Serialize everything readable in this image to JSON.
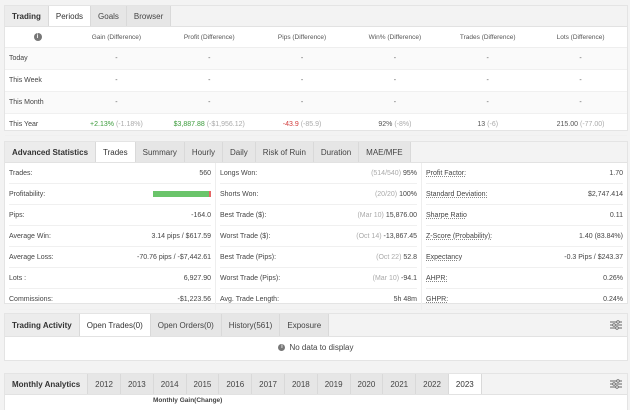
{
  "periods": {
    "tabs": [
      "Trading",
      "Periods",
      "Goals",
      "Browser"
    ],
    "headers": [
      "Gain (Difference)",
      "Profit (Difference)",
      "Pips (Difference)",
      "Win% (Difference)",
      "Trades (Difference)",
      "Lots (Difference)"
    ],
    "rows": [
      {
        "label": "Today",
        "gain": "-",
        "gain_diff": "",
        "profit": "-",
        "profit_diff": "",
        "pips": "-",
        "pips_diff": "",
        "win": "-",
        "win_diff": "",
        "trades": "-",
        "trades_diff": "",
        "lots": "-",
        "lots_diff": ""
      },
      {
        "label": "This Week",
        "gain": "-",
        "gain_diff": "",
        "profit": "-",
        "profit_diff": "",
        "pips": "-",
        "pips_diff": "",
        "win": "-",
        "win_diff": "",
        "trades": "-",
        "trades_diff": "",
        "lots": "-",
        "lots_diff": ""
      },
      {
        "label": "This Month",
        "gain": "-",
        "gain_diff": "",
        "profit": "-",
        "profit_diff": "",
        "pips": "-",
        "pips_diff": "",
        "win": "-",
        "win_diff": "",
        "trades": "-",
        "trades_diff": "",
        "lots": "-",
        "lots_diff": ""
      },
      {
        "label": "This Year",
        "gain": "+2.13%",
        "gain_diff": "(-1.18%)",
        "profit": "$3,887.88",
        "profit_diff": "(-$1,956.12)",
        "pips": "-43.9",
        "pips_diff": "(-85.9)",
        "win": "92%",
        "win_diff": "(-8%)",
        "trades": "13",
        "trades_diff": "(-6)",
        "lots": "215.00",
        "lots_diff": "(-77.00)"
      }
    ]
  },
  "stats": {
    "tabs": [
      "Advanced Statistics",
      "Trades",
      "Summary",
      "Hourly",
      "Daily",
      "Risk of Ruin",
      "Duration",
      "MAE/MFE"
    ],
    "col1": [
      {
        "label": "Trades:",
        "value": "560"
      },
      {
        "label": "Profitability:",
        "value": ""
      },
      {
        "label": "Pips:",
        "value": "-164.0"
      },
      {
        "label": "Average Win:",
        "value": "3.14 pips / $617.59"
      },
      {
        "label": "Average Loss:",
        "value": "-70.76 pips / -$7,442.61"
      },
      {
        "label": "Lots :",
        "value": "6,927.90"
      },
      {
        "label": "Commissions:",
        "value": "-$1,223.56"
      }
    ],
    "col2": [
      {
        "label": "Longs Won:",
        "sub": "(514/540)",
        "value": "95%"
      },
      {
        "label": "Shorts Won:",
        "sub": "(20/20)",
        "value": "100%"
      },
      {
        "label": "Best Trade ($):",
        "sub": "(Mar 10)",
        "value": "15,876.00"
      },
      {
        "label": "Worst Trade ($):",
        "sub": "(Oct 14)",
        "value": "-13,867.45"
      },
      {
        "label": "Best Trade (Pips):",
        "sub": "(Oct 22)",
        "value": "52.8"
      },
      {
        "label": "Worst Trade (Pips):",
        "sub": "(Mar 10)",
        "value": "-94.1"
      },
      {
        "label": "Avg. Trade Length:",
        "sub": "",
        "value": "5h 48m"
      }
    ],
    "col3": [
      {
        "label": "Profit Factor:",
        "value": "1.70"
      },
      {
        "label": "Standard Deviation:",
        "value": "$2,747.414"
      },
      {
        "label": "Sharpe Ratio",
        "value": "0.11"
      },
      {
        "label": "Z-Score (Probability):",
        "value": "1.40 (83.84%)"
      },
      {
        "label": "Expectancy",
        "value": "-0.3 Pips / $243.37"
      },
      {
        "label": "AHPR:",
        "value": "0.26%"
      },
      {
        "label": "GHPR:",
        "value": "0.24%"
      }
    ],
    "profitability_win_fraction": 0.96,
    "colors": {
      "win": "#6ac46a",
      "loss": "#e56565"
    }
  },
  "activity": {
    "tabs": [
      "Trading Activity",
      "Open Trades(0)",
      "Open Orders(0)",
      "History(561)",
      "Exposure"
    ],
    "nodata": "No data to display"
  },
  "monthly": {
    "tabs": [
      "Monthly Analytics",
      "2012",
      "2013",
      "2014",
      "2015",
      "2016",
      "2017",
      "2018",
      "2019",
      "2020",
      "2021",
      "2022",
      "2023"
    ],
    "subheader": "Monthly Gain(Change)"
  }
}
